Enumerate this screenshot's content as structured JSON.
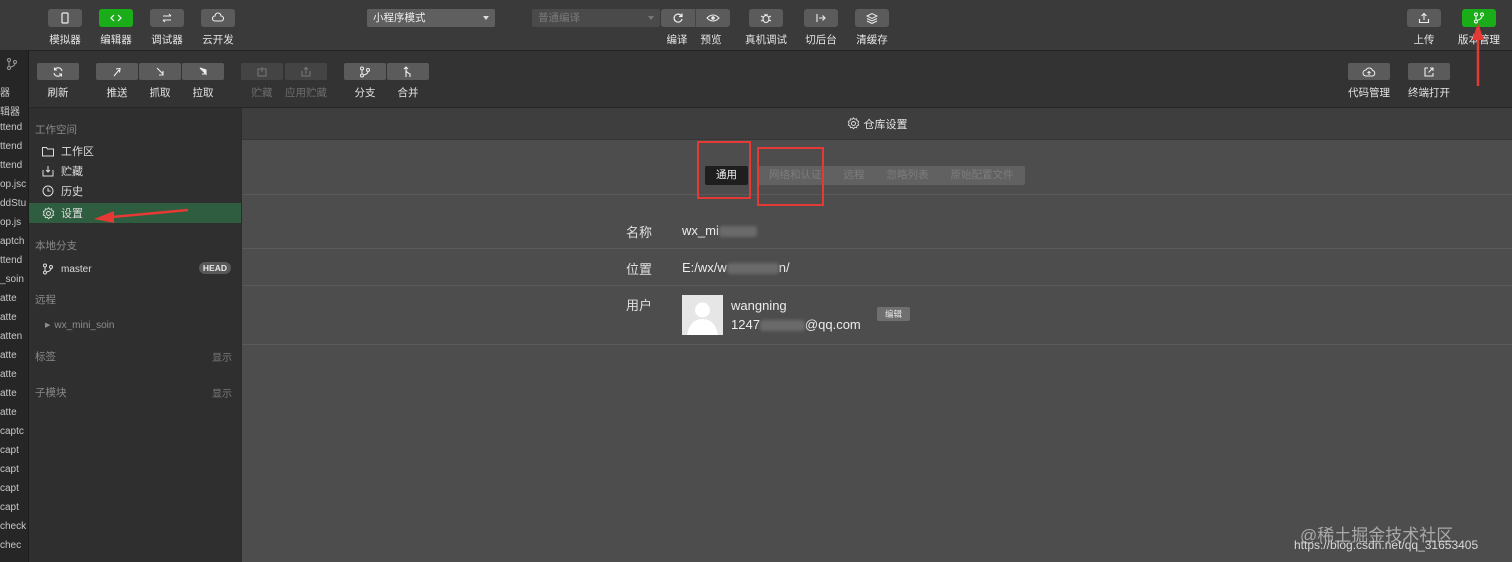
{
  "toolbar": {
    "simulator_label": "模拟器",
    "editor_label": "编辑器",
    "debugger_label": "调试器",
    "cloud_label": "云开发",
    "mode_select": "小程序模式",
    "compile_select": "普通编译",
    "compile_label": "编译",
    "preview_label": "预览",
    "real_debug_label": "真机调试",
    "background_label": "切后台",
    "clear_cache_label": "清缓存",
    "upload_label": "上传",
    "version_label": "版本管理"
  },
  "left_strip": {
    "items": [
      "器",
      "辑器",
      "ttend",
      "ttend",
      "ttend",
      "op.jsc",
      "ddStu",
      "op.js",
      "aptch",
      "ttend",
      "_soin",
      "atte",
      "atte",
      "atten",
      "atte",
      "atte",
      "atte",
      "atte",
      "captc",
      "capt",
      "capt",
      "capt",
      "capt",
      "check",
      "chec"
    ]
  },
  "vcs_toolbar": {
    "refresh_label": "刷新",
    "push_label": "推送",
    "fetch_label": "抓取",
    "pull_label": "拉取",
    "stash_label": "贮藏",
    "apply_stash_label": "应用贮藏",
    "branch_label": "分支",
    "merge_label": "合并",
    "code_manage_label": "代码管理",
    "terminal_label": "终端打开"
  },
  "sidebar": {
    "workspace_heading": "工作空间",
    "items": [
      {
        "label": "工作区",
        "icon": "folder-icon"
      },
      {
        "label": "贮藏",
        "icon": "stash-icon"
      },
      {
        "label": "历史",
        "icon": "history-icon"
      },
      {
        "label": "设置",
        "icon": "gear-icon"
      }
    ],
    "local_branch_heading": "本地分支",
    "branch_name": "master",
    "branch_badge": "HEAD",
    "remote_heading": "远程",
    "remote_name": "wx_mini_soin",
    "tags_heading": "标签",
    "tags_toggle": "显示",
    "submodule_heading": "子模块",
    "submodule_toggle": "显示"
  },
  "main": {
    "title": "仓库设置",
    "tabs": [
      "通用",
      "网络和认证",
      "远程",
      "忽略列表",
      "原始配置文件"
    ],
    "active_tab": "通用",
    "rows": {
      "name_label": "名称",
      "name_value": "wx_mi",
      "location_label": "位置",
      "location_value_a": "E:/wx/w",
      "location_value_b": "n/",
      "user_label": "用户",
      "user_name": "wangning",
      "user_email_a": "1247",
      "user_email_b": "@qq.com",
      "edit_button": "编辑"
    }
  },
  "watermark": {
    "line1": "@稀土掘金技术社区",
    "line2": "https://blog.csdn.net/qq_31653405"
  },
  "colors": {
    "accent_green": "#1aad19",
    "active_sidebar": "#2e5e3f",
    "annotation_red": "#e53935"
  }
}
